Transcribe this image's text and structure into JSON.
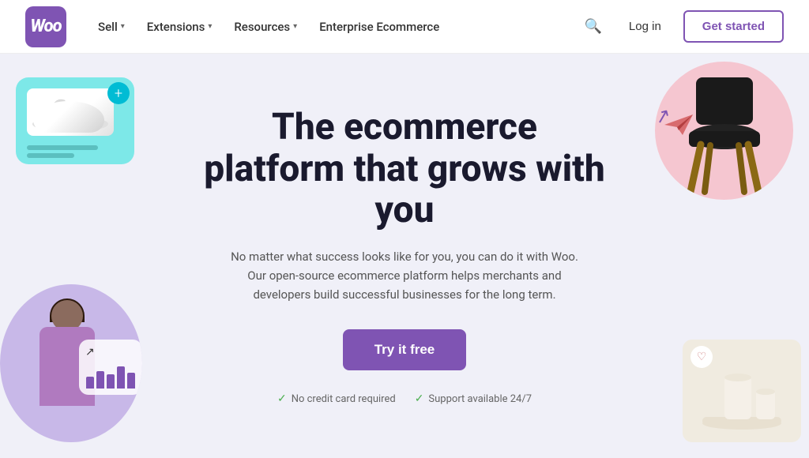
{
  "nav": {
    "logo_text": "Woo",
    "sell_label": "Sell",
    "extensions_label": "Extensions",
    "resources_label": "Resources",
    "enterprise_label": "Enterprise Ecommerce",
    "login_label": "Log in",
    "get_started_label": "Get started"
  },
  "hero": {
    "title": "The ecommerce platform that grows with you",
    "description": "No matter what success looks like for you, you can do it with Woo. Our open-source ecommerce platform helps merchants and developers build successful businesses for the long term.",
    "cta_label": "Try it free",
    "badge1": "No credit card required",
    "badge2": "Support available 24/7"
  },
  "colors": {
    "brand": "#7f54b3",
    "cta_bg": "#7f54b3",
    "trust_green": "#4caf50"
  }
}
